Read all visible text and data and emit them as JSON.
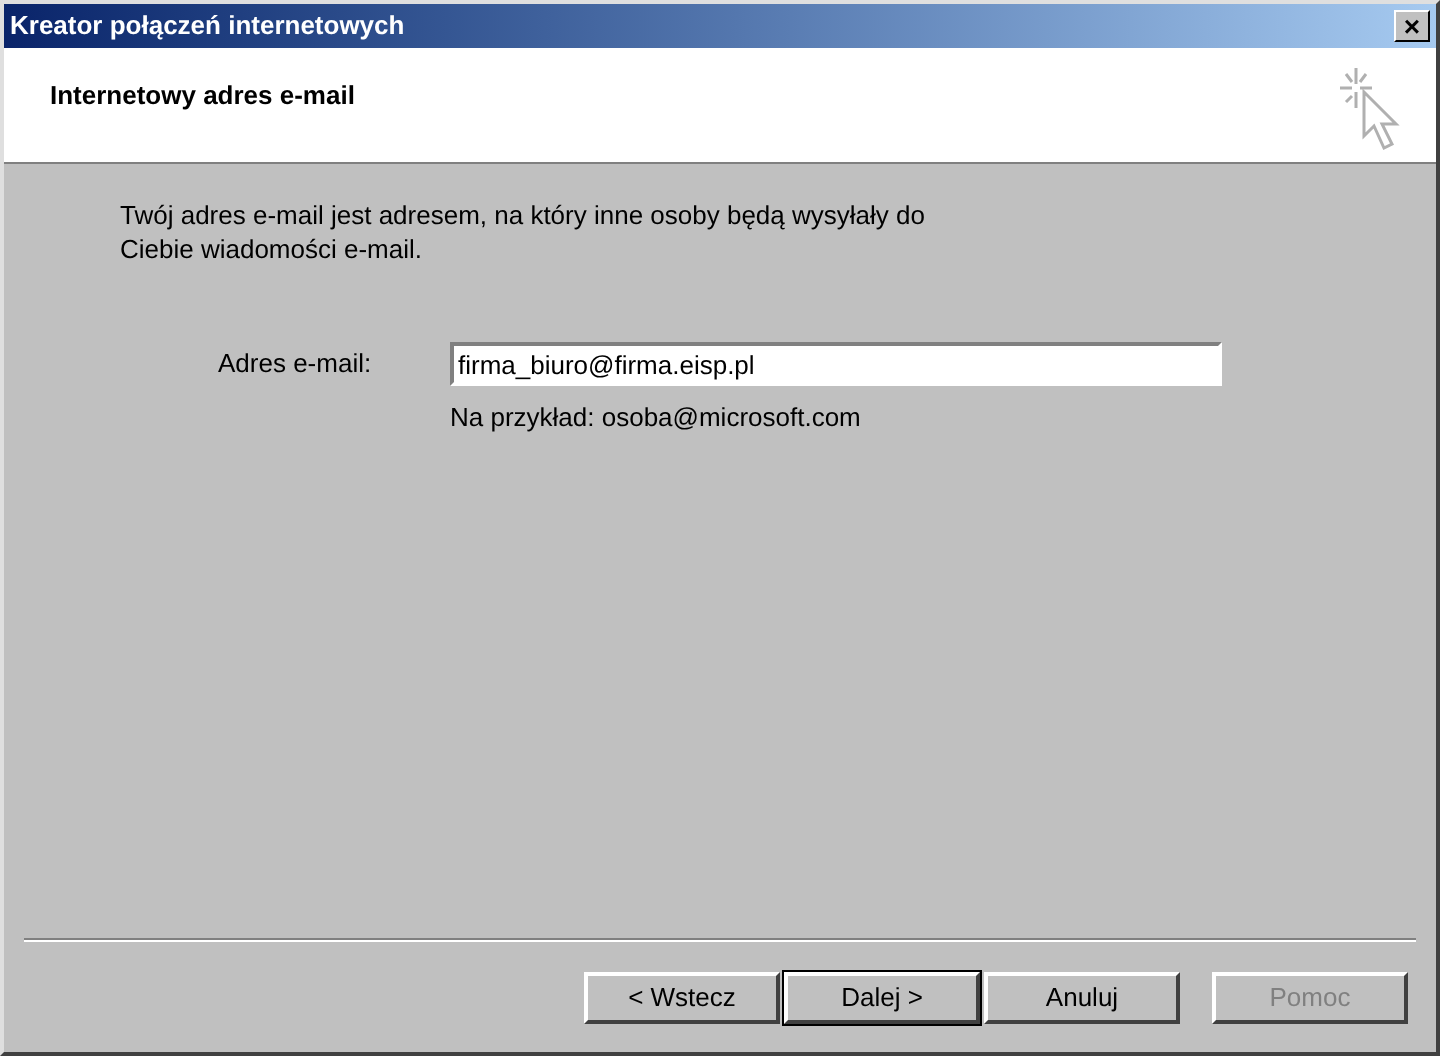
{
  "window": {
    "title": "Kreator połączeń internetowych",
    "close": "×"
  },
  "header": {
    "title": "Internetowy adres e-mail"
  },
  "intro": "Twój adres e-mail jest adresem, na który inne osoby będą wysyłały do Ciebie wiadomości e-mail.",
  "email": {
    "label": "Adres e-mail:",
    "value": "firma_biuro@firma.eisp.pl",
    "hint": "Na przykład: osoba@microsoft.com"
  },
  "buttons": [
    {
      "label": "< Wstecz",
      "default": false,
      "disabled": false
    },
    {
      "label": "Dalej >",
      "default": true,
      "disabled": false
    },
    {
      "label": "Anuluj",
      "default": false,
      "disabled": false
    },
    {
      "label": "Pomoc",
      "default": false,
      "disabled": true
    }
  ]
}
